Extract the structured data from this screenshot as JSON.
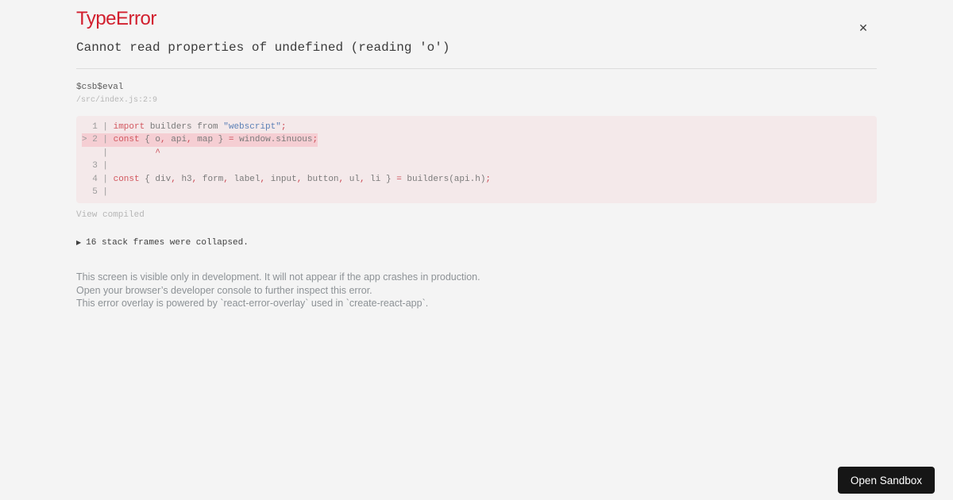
{
  "overlay": {
    "title": "TypeError",
    "close_label": "✕",
    "message": "Cannot read properties of undefined (reading 'o')",
    "frame": {
      "function": "$csb$eval",
      "location": "/src/index.js:2:9"
    },
    "code_frame": {
      "lines": [
        {
          "gutter": "  1 | ",
          "highlighted": false,
          "tokens": [
            {
              "c": "k",
              "t": "import"
            },
            {
              "c": "d",
              "t": " builders from "
            },
            {
              "c": "s",
              "t": "\"webscript\""
            },
            {
              "c": "p",
              "t": ";"
            }
          ]
        },
        {
          "gutter": "> 2 | ",
          "highlighted": true,
          "tokens": [
            {
              "c": "k",
              "t": "const"
            },
            {
              "c": "d",
              "t": " { o"
            },
            {
              "c": "p",
              "t": ","
            },
            {
              "c": "d",
              "t": " api"
            },
            {
              "c": "p",
              "t": ","
            },
            {
              "c": "d",
              "t": " map } "
            },
            {
              "c": "p",
              "t": "="
            },
            {
              "c": "d",
              "t": " window.sinuous"
            },
            {
              "c": "p",
              "t": ";"
            }
          ]
        },
        {
          "gutter": "    | ",
          "highlighted": false,
          "tokens": [
            {
              "c": "p",
              "t": "        ^"
            }
          ]
        },
        {
          "gutter": "  3 | ",
          "highlighted": false,
          "tokens": []
        },
        {
          "gutter": "  4 | ",
          "highlighted": false,
          "tokens": [
            {
              "c": "k",
              "t": "const"
            },
            {
              "c": "d",
              "t": " { div"
            },
            {
              "c": "p",
              "t": ","
            },
            {
              "c": "d",
              "t": " h3"
            },
            {
              "c": "p",
              "t": ","
            },
            {
              "c": "d",
              "t": " form"
            },
            {
              "c": "p",
              "t": ","
            },
            {
              "c": "d",
              "t": " label"
            },
            {
              "c": "p",
              "t": ","
            },
            {
              "c": "d",
              "t": " input"
            },
            {
              "c": "p",
              "t": ","
            },
            {
              "c": "d",
              "t": " button"
            },
            {
              "c": "p",
              "t": ","
            },
            {
              "c": "d",
              "t": " ul"
            },
            {
              "c": "p",
              "t": ","
            },
            {
              "c": "d",
              "t": " li } "
            },
            {
              "c": "p",
              "t": "="
            },
            {
              "c": "d",
              "t": " builders(api.h)"
            },
            {
              "c": "p",
              "t": ";"
            }
          ]
        },
        {
          "gutter": "  5 | ",
          "highlighted": false,
          "tokens": []
        }
      ]
    },
    "view_compiled_label": "View compiled",
    "collapsed": {
      "icon": "▶",
      "text": "16 stack frames were collapsed."
    },
    "footer_lines": [
      "This screen is visible only in development. It will not appear if the app crashes in production.",
      "Open your browser’s developer console to further inspect this error.",
      "This error overlay is powered by `react-error-overlay` used in `create-react-app`."
    ]
  },
  "sandbox": {
    "button_label": "Open Sandbox"
  },
  "colors": {
    "title_red": "#d21f2e",
    "keyword_red": "#d2565e",
    "string_blue": "#5c80b6",
    "highlight_pink": "#f5ced3",
    "code_block_pink": "#f4e9ea",
    "button_black": "#161616"
  }
}
